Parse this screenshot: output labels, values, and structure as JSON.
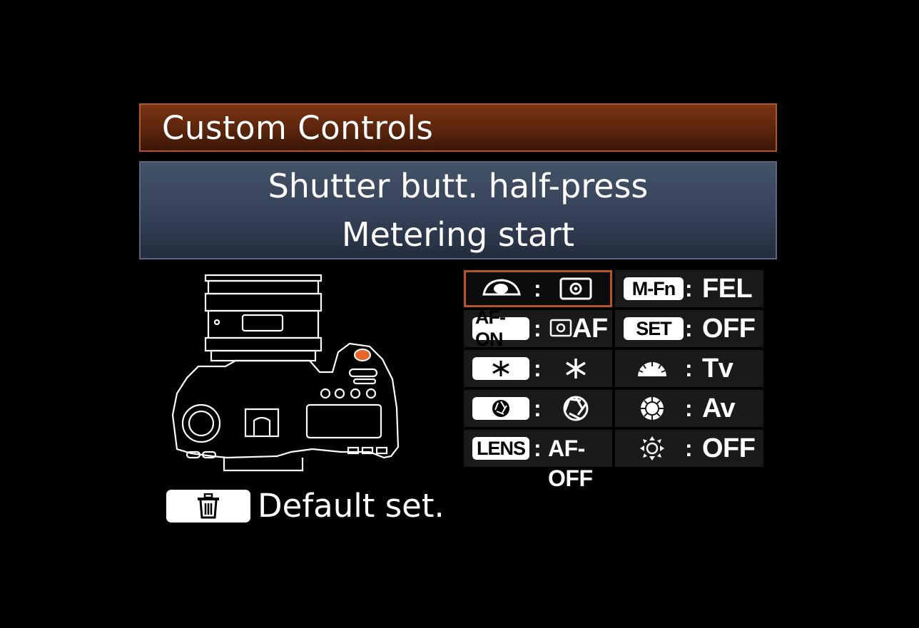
{
  "screen_title": "Custom Controls",
  "function": {
    "button_name": "Shutter butt. half-press",
    "assignment": "Metering start"
  },
  "controls": [
    {
      "id": "shutter",
      "control_icon": "shutter-half-press-icon",
      "value": "",
      "value_icon": "metering-icon",
      "selected": true
    },
    {
      "id": "mfn",
      "control_label": "M-Fn",
      "value": "FEL",
      "selected": false
    },
    {
      "id": "afon",
      "control_label": "AF-ON",
      "value": "AF",
      "value_icon": "metering-icon",
      "selected": false
    },
    {
      "id": "set",
      "control_label": "SET",
      "value": "OFF",
      "selected": false
    },
    {
      "id": "ae-lock",
      "control_icon": "ae-lock-button-icon",
      "value": "",
      "value_icon": "asterisk-icon",
      "selected": false
    },
    {
      "id": "main-dial",
      "control_icon": "main-dial-icon",
      "value": "Tv",
      "selected": false
    },
    {
      "id": "dof-preview",
      "control_icon": "dof-preview-button-icon",
      "value": "",
      "value_icon": "aperture-icon",
      "selected": false
    },
    {
      "id": "quick-dial",
      "control_icon": "quick-control-dial-icon",
      "value": "Av",
      "selected": false
    },
    {
      "id": "lens",
      "control_label": "LENS",
      "value": "AF-OFF",
      "selected": false
    },
    {
      "id": "multi-controller",
      "control_icon": "multi-controller-icon",
      "value": "OFF",
      "selected": false
    }
  ],
  "colon": ":",
  "footer": {
    "button_icon": "trash-icon",
    "label": "Default set."
  },
  "colors": {
    "accent": "#b4562a",
    "title_bg": "#5a250c",
    "function_bg": "#36435a",
    "background": "#000000"
  }
}
